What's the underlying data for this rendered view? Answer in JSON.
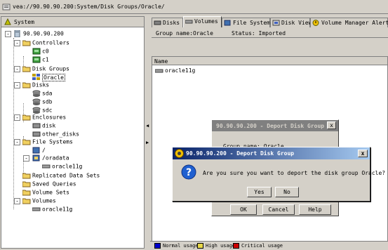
{
  "address": {
    "path": "vea://90.90.90.200:System/Disk Groups/Oracle/"
  },
  "left_pane": {
    "title": "System",
    "tree": {
      "root": "90.90.90.200",
      "controllers": {
        "label": "Controllers",
        "items": [
          "c0",
          "c1"
        ]
      },
      "disk_groups": {
        "label": "Disk Groups",
        "items": [
          "Oracle"
        ]
      },
      "disks": {
        "label": "Disks",
        "items": [
          "sda",
          "sdb",
          "sdc"
        ]
      },
      "enclosures": {
        "label": "Enclosures",
        "items": [
          "disk",
          "other_disks"
        ]
      },
      "file_systems": {
        "label": "File Systems",
        "items": [
          "/",
          "/oradata"
        ],
        "sub_items": [
          "oracle11g"
        ]
      },
      "replicated_data_sets": "Replicated Data Sets",
      "saved_queries": "Saved Queries",
      "volume_sets": "Volume Sets",
      "volumes": {
        "label": "Volumes",
        "items": [
          "oracle11g"
        ]
      }
    }
  },
  "right_pane": {
    "tabs": [
      "Disks",
      "Volumes",
      "File Systems",
      "Disk View",
      "Volume Manager Alerts"
    ],
    "active_tab": "Volumes",
    "group_name": "Group name:Oracle",
    "status": "Status: Imported",
    "column_name": "Name",
    "rows": [
      "oracle11g"
    ],
    "legend": [
      {
        "label": "Normal usage",
        "color": "#0000cc"
      },
      {
        "label": "High usage",
        "color": "#e8d84a"
      },
      {
        "label": "Critical usage",
        "color": "#cc0000"
      }
    ]
  },
  "background_dialog": {
    "title": "90.90.90.200 - Deport Disk Group",
    "group_name": "Group name: Oracle",
    "buttons": {
      "ok": "OK",
      "cancel": "Cancel",
      "help": "Help"
    }
  },
  "confirm_dialog": {
    "title": "90.90.90.200 - Deport Disk Group",
    "message": "Are you sure you want to deport the disk group Oracle?",
    "buttons": {
      "yes": "Yes",
      "no": "No"
    },
    "close": "x"
  }
}
